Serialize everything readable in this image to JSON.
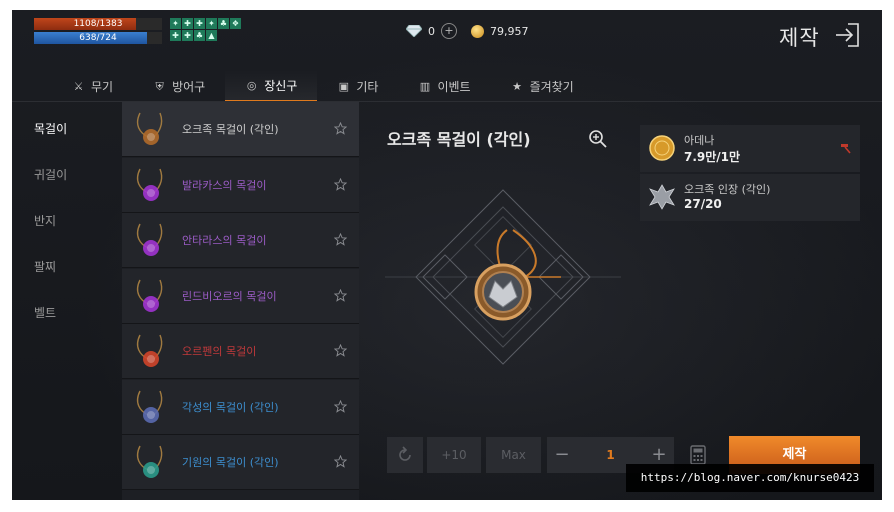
{
  "status": {
    "hp_text": "1108/1383",
    "hp_fraction": 0.8,
    "mp_text": "638/724",
    "mp_fraction": 0.88,
    "buff_icons": [
      "buff-icon",
      "buff-icon",
      "buff-icon",
      "buff-icon",
      "buff-icon",
      "buff-icon",
      "buff-icon",
      "buff-icon",
      "buff-icon",
      "buff-icon"
    ]
  },
  "currency": {
    "diamond": "0",
    "adena": "79,957"
  },
  "header": {
    "title": "제작"
  },
  "tabs": [
    {
      "label": "무기",
      "icon": "sword-icon",
      "glyph": "⚔"
    },
    {
      "label": "방어구",
      "icon": "armor-icon",
      "glyph": "⛨"
    },
    {
      "label": "장신구",
      "icon": "ring-icon",
      "glyph": "◎"
    },
    {
      "label": "기타",
      "icon": "box-icon",
      "glyph": "▣"
    },
    {
      "label": "이벤트",
      "icon": "event-icon",
      "glyph": "▥"
    },
    {
      "label": "즐겨찾기",
      "icon": "star-icon",
      "glyph": "★"
    }
  ],
  "active_tab": 2,
  "subcategories": [
    "목걸이",
    "귀걸이",
    "반지",
    "팔찌",
    "벨트"
  ],
  "items": [
    {
      "name": "오크족 목걸이 (각인)",
      "color": "#cfcfcf",
      "gem": "#b06a2a"
    },
    {
      "name": "발라카스의 목걸이",
      "color": "#9b5cc6",
      "gem": "#a033d0"
    },
    {
      "name": "안타라스의 목걸이",
      "color": "#9b5cc6",
      "gem": "#a033d0"
    },
    {
      "name": "린드비오르의 목걸이",
      "color": "#9b5cc6",
      "gem": "#a033d0"
    },
    {
      "name": "오르펜의 목걸이",
      "color": "#c0393b",
      "gem": "#d0452a"
    },
    {
      "name": "각성의 목걸이 (각인)",
      "color": "#3d8fd0",
      "gem": "#5a6ab0"
    },
    {
      "name": "기원의 목걸이 (각인)",
      "color": "#3d8fd0",
      "gem": "#2a9a8a"
    }
  ],
  "selected_item": {
    "title": "오크족 목걸이 (각인)"
  },
  "materials": [
    {
      "name": "아데나",
      "qty": "7.9만/1만",
      "icon": "adena-coin-icon"
    },
    {
      "name": "오크족 인장 (각인)",
      "qty": "27/20",
      "icon": "orc-seal-icon"
    }
  ],
  "controls": {
    "plus10": "+10",
    "max": "Max",
    "quantity": "1",
    "minus": "−",
    "plus": "+",
    "craft_label": "제작"
  },
  "watermark": "https://blog.naver.com/knurse0423"
}
